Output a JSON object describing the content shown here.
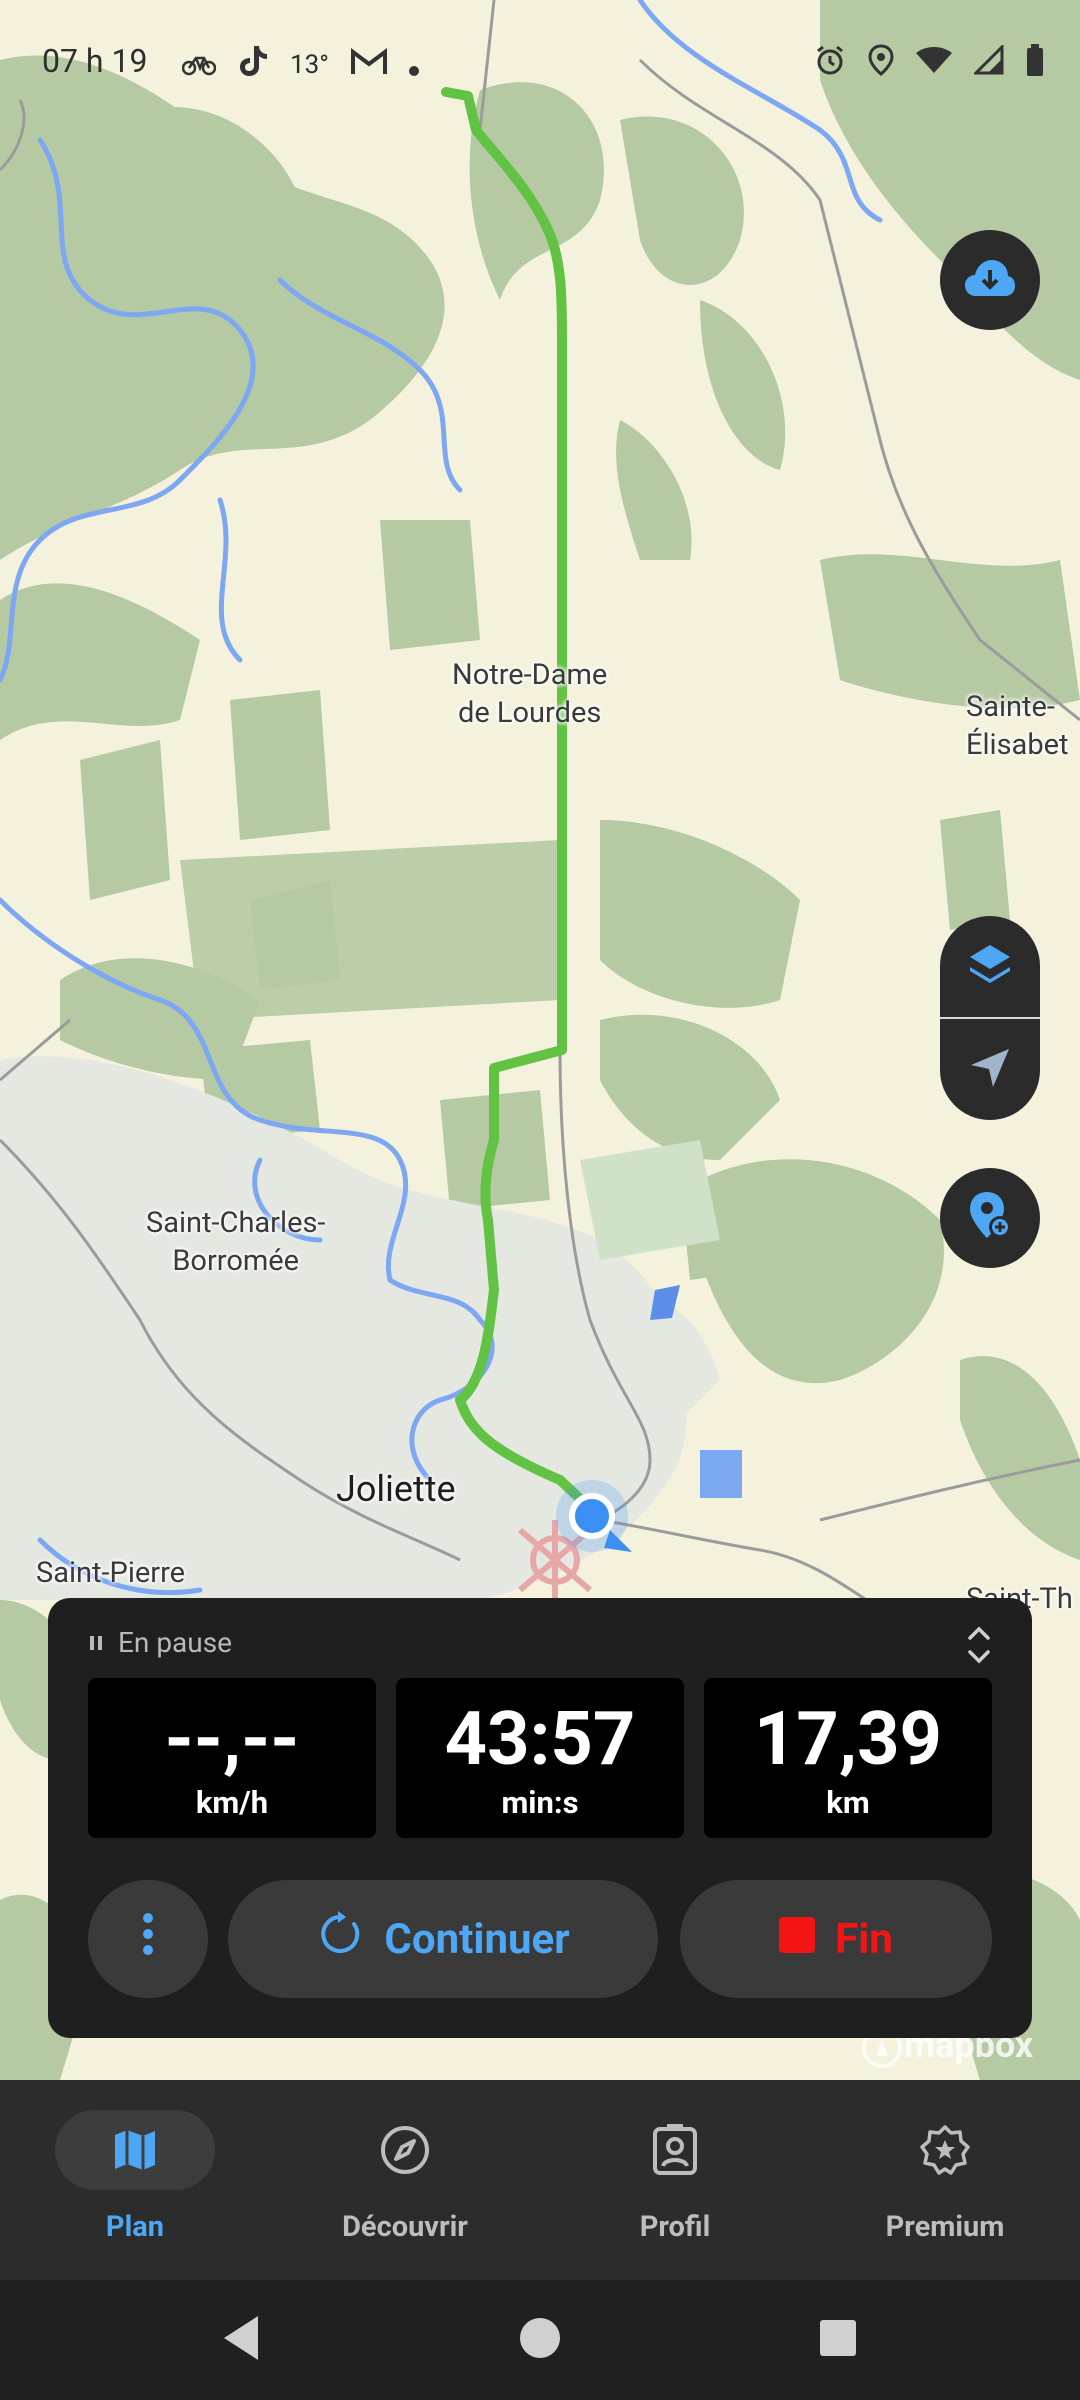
{
  "status_bar": {
    "time": "07 h 19",
    "temperature": "13°",
    "left_icons": [
      "bike-icon",
      "tiktok-icon",
      "gmail-icon",
      "dot-icon"
    ],
    "right_icons": [
      "alarm-icon",
      "location-icon",
      "wifi-icon",
      "signal-icon",
      "battery-icon"
    ]
  },
  "map": {
    "places": [
      {
        "name": "Notre-Dame\nde Lourdes"
      },
      {
        "name": "Sainte-\nÉlisabet"
      },
      {
        "name": "Saint-Charles-\nBorromée"
      },
      {
        "name": "Joliette"
      },
      {
        "name": "Saint-Pierre"
      },
      {
        "name": "Saint-Th"
      }
    ],
    "attribution": "mapbox",
    "route_color": "#62c244",
    "location_color": "#3b8ff3"
  },
  "fabs": {
    "download": "cloud-download-icon",
    "layers": "layers-icon",
    "locate": "navigation-arrow-icon",
    "add_poi": "add-location-icon"
  },
  "tracking_panel": {
    "status": "En pause",
    "stats": [
      {
        "value": "--,--",
        "unit": "km/h"
      },
      {
        "value": "43:57",
        "unit": "min:s"
      },
      {
        "value": "17,39",
        "unit": "km"
      }
    ],
    "continue_label": "Continuer",
    "end_label": "Fin",
    "accent": "#4ea7f5",
    "danger": "#f31414"
  },
  "bottom_nav": {
    "items": [
      {
        "label": "Plan",
        "icon": "map-icon",
        "active": true
      },
      {
        "label": "Découvrir",
        "icon": "compass-icon",
        "active": false
      },
      {
        "label": "Profil",
        "icon": "profile-icon",
        "active": false
      },
      {
        "label": "Premium",
        "icon": "premium-badge-icon",
        "active": false
      }
    ]
  }
}
